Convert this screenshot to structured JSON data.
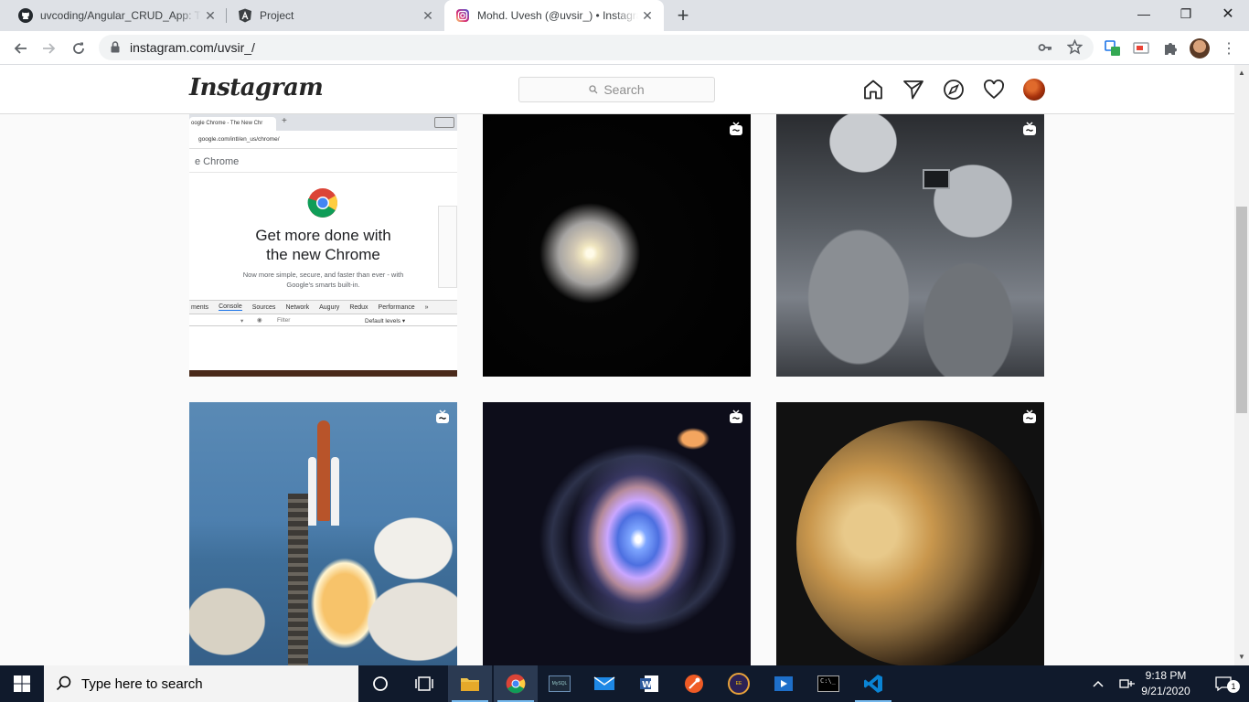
{
  "browser": {
    "tabs": [
      {
        "title": "uvcoding/Angular_CRUD_App: Th",
        "icon": "github-icon"
      },
      {
        "title": "Project",
        "icon": "angular-icon"
      },
      {
        "title": "Mohd. Uvesh (@uvsir_) • Instagra",
        "icon": "instagram-icon",
        "active": true
      }
    ],
    "url": "instagram.com/uvsir_/"
  },
  "instagram": {
    "logo": "Instagram",
    "search_placeholder": "Search"
  },
  "posts": {
    "row1_col1": {
      "tab_text": "oogle Chrome - The New Chr",
      "address": "google.com/intl/en_us/chrome/",
      "heading_partial": "e Chrome",
      "headline_line1": "Get more done with",
      "headline_line2": "the new Chrome",
      "sub_line1": "Now more simple, secure, and faster than ever - with",
      "sub_line2": "Google's smarts built-in.",
      "devtools_tabs": [
        "ments",
        "Console",
        "Sources",
        "Network",
        "Augury",
        "Redux",
        "Performance",
        "»"
      ],
      "filter": "Filter",
      "levels": "Default levels ▾"
    }
  },
  "taskbar": {
    "search_placeholder": "Type here to search",
    "time": "9:18 PM",
    "date": "9/21/2020",
    "notifications": "1"
  },
  "colors": {
    "taskbar": "#101a2c",
    "instagram_text": "#262626"
  }
}
